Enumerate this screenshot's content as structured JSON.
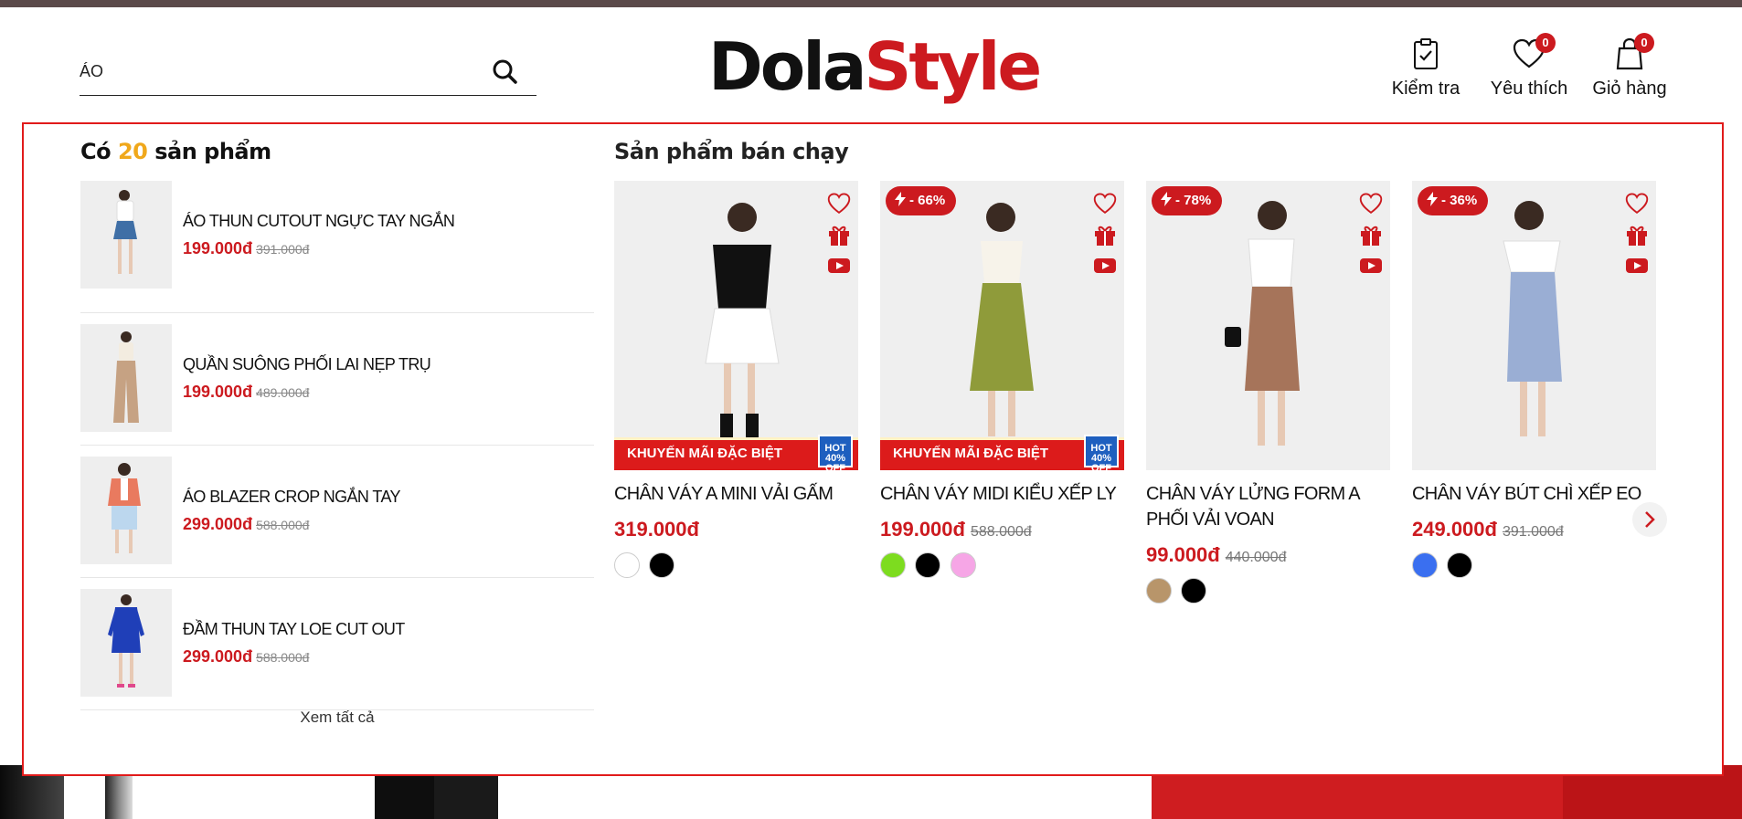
{
  "search": {
    "value": "ÁO",
    "placeholder": ""
  },
  "logo": {
    "part1": "Dola",
    "part2": "Style"
  },
  "header_actions": [
    {
      "label": "Kiểm tra",
      "icon": "clipboard-check-icon"
    },
    {
      "label": "Yêu thích",
      "icon": "heart-icon",
      "badge": "0"
    },
    {
      "label": "Giỏ hàng",
      "icon": "shopping-bag-icon",
      "badge": "0"
    }
  ],
  "results": {
    "title_prefix": "Có",
    "count": "20",
    "title_suffix": "sản phẩm",
    "items": [
      {
        "name": "ÁO THUN CUTOUT NGỰC TAY NGẮN",
        "price": "199.000đ",
        "old_price": "391.000đ"
      },
      {
        "name": "QUẦN SUÔNG PHỐI LAI NẸP TRỤ",
        "price": "199.000đ",
        "old_price": "489.000đ"
      },
      {
        "name": "ÁO BLAZER CROP NGẮN TAY",
        "price": "299.000đ",
        "old_price": "588.000đ"
      },
      {
        "name": "ĐẦM THUN TAY LOE CUT OUT",
        "price": "299.000đ",
        "old_price": "588.000đ"
      }
    ],
    "see_all": "Xem tất cả"
  },
  "best_sellers": {
    "title": "Sản phẩm bán chạy",
    "products": [
      {
        "name": "CHÂN VÁY A MINI VẢI GẤM",
        "price": "319.000đ",
        "old_price": "",
        "discount": "",
        "promo": "KHUYẾN MÃI ĐẶC BIỆT",
        "promo_badge": "HOT 40% OFF",
        "swatches": [
          "#ffffff",
          "#000000"
        ]
      },
      {
        "name": "CHÂN VÁY MIDI KIỂU XẾP LY",
        "price": "199.000đ",
        "old_price": "588.000đ",
        "discount": "- 66%",
        "promo": "KHUYẾN MÃI ĐẶC BIỆT",
        "promo_badge": "HOT 40% OFF",
        "swatches": [
          "#7ddc1f",
          "#000000",
          "#f6a6e6"
        ]
      },
      {
        "name": "CHÂN VÁY LỬNG FORM A PHỐI VẢI VOAN",
        "price": "99.000đ",
        "old_price": "440.000đ",
        "discount": "- 78%",
        "promo": "",
        "promo_badge": "",
        "swatches": [
          "#b8956a",
          "#000000"
        ]
      },
      {
        "name": "CHÂN VÁY BÚT CHÌ XẾP EO",
        "price": "249.000đ",
        "old_price": "391.000đ",
        "discount": "- 36%",
        "promo": "",
        "promo_badge": "",
        "swatches": [
          "#3a6ff0",
          "#000000"
        ]
      }
    ]
  },
  "colors": {
    "accent": "#cc1a1f",
    "count_highlight": "#f0a81b",
    "panel_border": "#e11b1b"
  }
}
